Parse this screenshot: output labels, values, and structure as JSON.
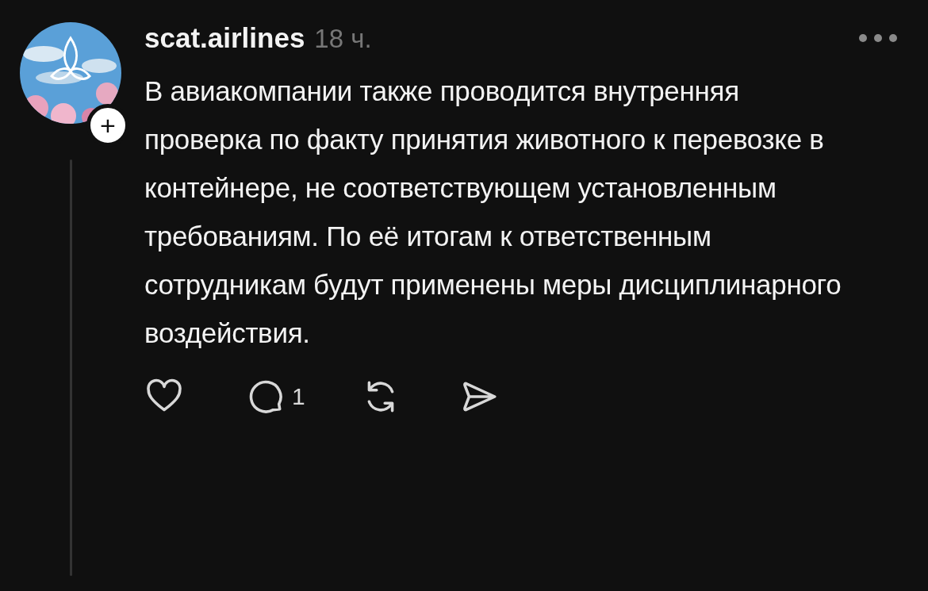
{
  "post": {
    "username": "scat.airlines",
    "time": "18 ч.",
    "text": "В авиакомпании также проводится внутренняя проверка по факту принятия животного к перевозке в контейнере, не соответствующем установленным требованиям. По её итогам к ответственным сотрудникам будут применены меры дисциплинарного воздействия.",
    "follow_badge": "+",
    "liked": false,
    "reply_count": "1"
  }
}
